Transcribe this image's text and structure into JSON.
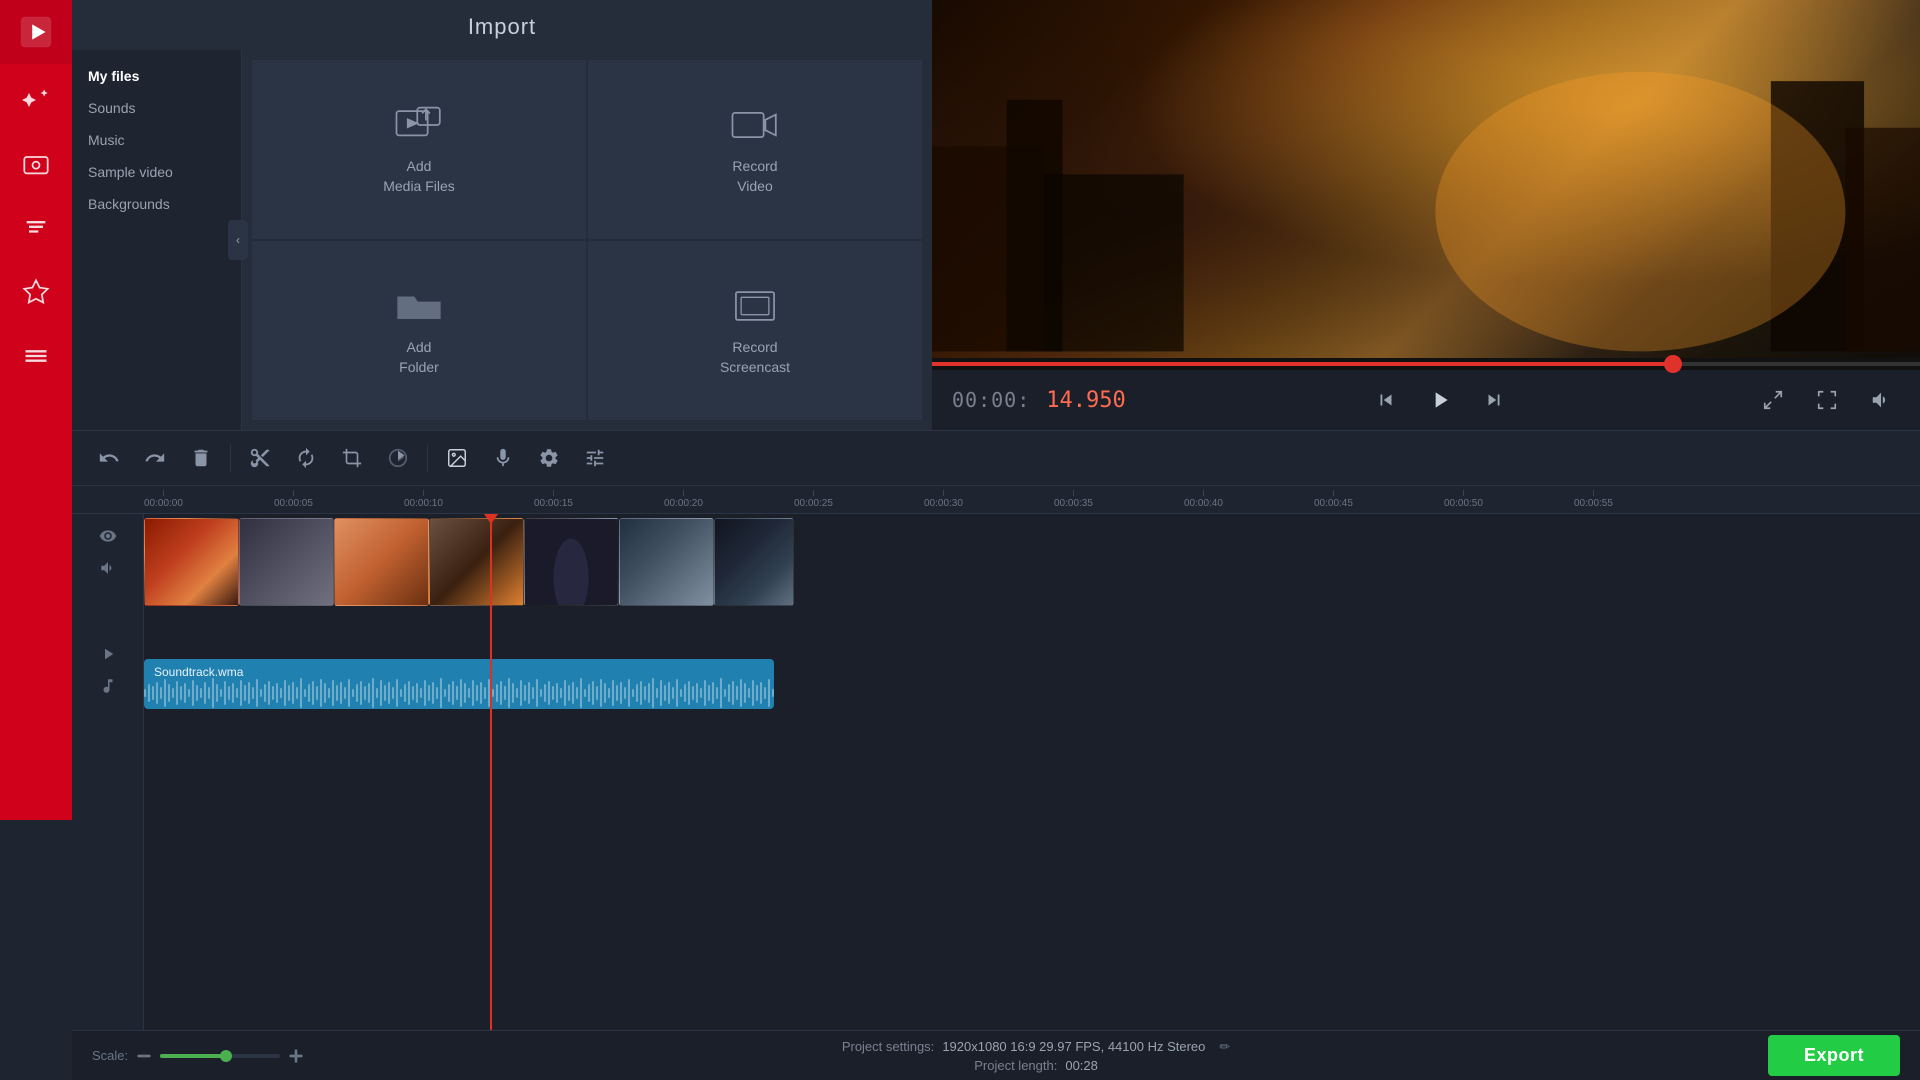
{
  "app": {
    "title": "Import"
  },
  "toolbar": {
    "items": [
      {
        "name": "film-icon",
        "label": "Media"
      },
      {
        "name": "magic-icon",
        "label": "Effects"
      },
      {
        "name": "clip-icon",
        "label": "Clips"
      },
      {
        "name": "text-icon",
        "label": "Text"
      },
      {
        "name": "star-icon",
        "label": "Favorites"
      },
      {
        "name": "list-icon",
        "label": "List"
      }
    ]
  },
  "import": {
    "title": "Import",
    "sidebar": {
      "items": [
        {
          "label": "My files",
          "active": true
        },
        {
          "label": "Sounds",
          "active": false
        },
        {
          "label": "Music",
          "active": false
        },
        {
          "label": "Sample video",
          "active": false
        },
        {
          "label": "Backgrounds",
          "active": false
        }
      ]
    },
    "grid": [
      {
        "label": "Add\nMedia Files",
        "name": "add-media-files-card"
      },
      {
        "label": "Record\nVideo",
        "name": "record-video-card"
      },
      {
        "label": "Add\nFolder",
        "name": "add-folder-card"
      },
      {
        "label": "Record\nScreencast",
        "name": "record-screencast-card"
      }
    ]
  },
  "video_controls": {
    "time_prefix": "00:00:",
    "time_current": "14.950",
    "buttons": {
      "skip_back": "⏮",
      "play": "▶",
      "skip_forward": "⏭",
      "export_screen": "⤢",
      "fullscreen": "⛶",
      "volume": "🔊"
    },
    "progress_percent": 75
  },
  "toolbar_row": {
    "buttons": [
      {
        "name": "undo-button",
        "label": "↩"
      },
      {
        "name": "redo-button",
        "label": "↪"
      },
      {
        "name": "delete-button",
        "label": "🗑"
      },
      {
        "name": "cut-button",
        "label": "✂"
      },
      {
        "name": "rotate-button",
        "label": "↻"
      },
      {
        "name": "crop-button",
        "label": "⊡"
      },
      {
        "name": "color-button",
        "label": "◑"
      },
      {
        "name": "image-button",
        "label": "🖼"
      },
      {
        "name": "mic-button",
        "label": "🎙"
      },
      {
        "name": "settings-button",
        "label": "⚙"
      },
      {
        "name": "adjust-button",
        "label": "⧎"
      }
    ]
  },
  "timeline": {
    "ruler_marks": [
      "00:00:00",
      "00:00:05",
      "00:00:10",
      "00:00:15",
      "00:00:20",
      "00:00:25",
      "00:00:30",
      "00:00:35",
      "00:00:40",
      "00:00:45",
      "00:00:50",
      "00:00:55"
    ],
    "playhead_position": "346px",
    "clips": [
      {
        "id": 1,
        "class": "clip-1"
      },
      {
        "id": 2,
        "class": "clip-2"
      },
      {
        "id": 3,
        "class": "clip-3"
      },
      {
        "id": 4,
        "class": "clip-4"
      },
      {
        "id": 5,
        "class": "clip-5"
      },
      {
        "id": 6,
        "class": "clip-6"
      },
      {
        "id": 7,
        "class": "clip-7"
      }
    ],
    "audio_clip": {
      "label": "Soundtrack.wma"
    }
  },
  "status_bar": {
    "scale_label": "Scale:",
    "project_settings_label": "Project settings:",
    "project_settings_value": "1920x1080 16:9 29.97 FPS, 44100 Hz Stereo",
    "project_length_label": "Project length:",
    "project_length_value": "00:28",
    "export_label": "Export"
  }
}
